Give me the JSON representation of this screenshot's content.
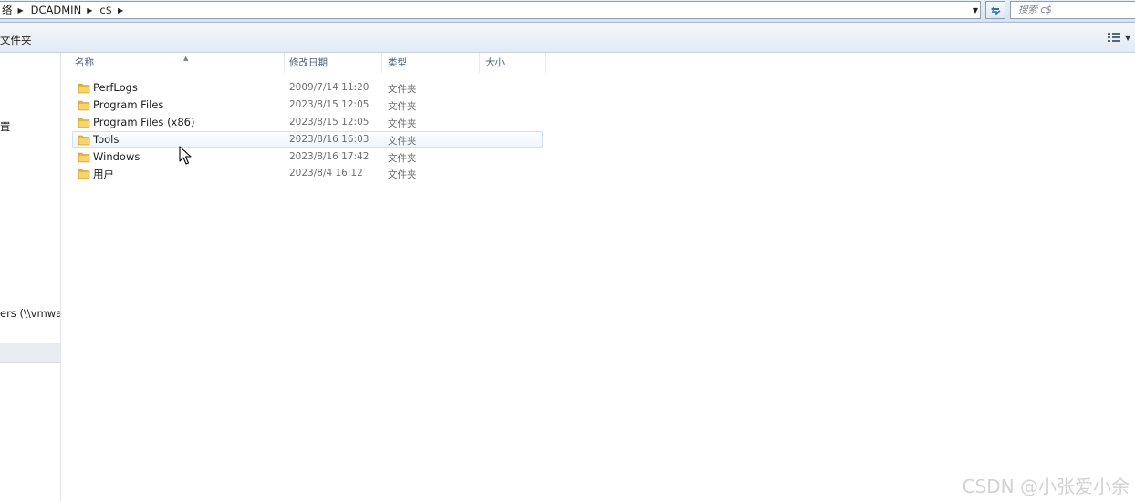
{
  "address": {
    "crumbs": [
      "网络",
      "DCADMIN",
      "c$"
    ],
    "crumb_display": [
      "络",
      "DCADMIN",
      "c$"
    ]
  },
  "search": {
    "placeholder": "搜索 c$"
  },
  "toolbar": {
    "new_folder_label": "文件夹"
  },
  "nav": {
    "items": [
      {
        "label": "置"
      },
      {
        "label": "ers (\\\\vmwar"
      }
    ]
  },
  "columns": {
    "name": "名称",
    "date": "修改日期",
    "type": "类型",
    "size": "大小"
  },
  "files": [
    {
      "name": "PerfLogs",
      "date": "2009/7/14 11:20",
      "type": "文件夹"
    },
    {
      "name": "Program Files",
      "date": "2023/8/15 12:05",
      "type": "文件夹"
    },
    {
      "name": "Program Files (x86)",
      "date": "2023/8/15 12:05",
      "type": "文件夹"
    },
    {
      "name": "Tools",
      "date": "2023/8/16 16:03",
      "type": "文件夹"
    },
    {
      "name": "Windows",
      "date": "2023/8/16 17:42",
      "type": "文件夹"
    },
    {
      "name": "用户",
      "date": "2023/8/4 16:12",
      "type": "文件夹"
    }
  ],
  "hovered_row": "Tools",
  "watermark": "CSDN @小张爱小余",
  "colors": {
    "folder": "#e8b53a",
    "header_text": "#4c607a",
    "hover_border": "#d2e0f2"
  },
  "icons": [
    "folder-icon",
    "refresh-icon",
    "view-options-icon",
    "mouse-cursor-icon",
    "chevron-right-icon",
    "dropdown-icon"
  ]
}
